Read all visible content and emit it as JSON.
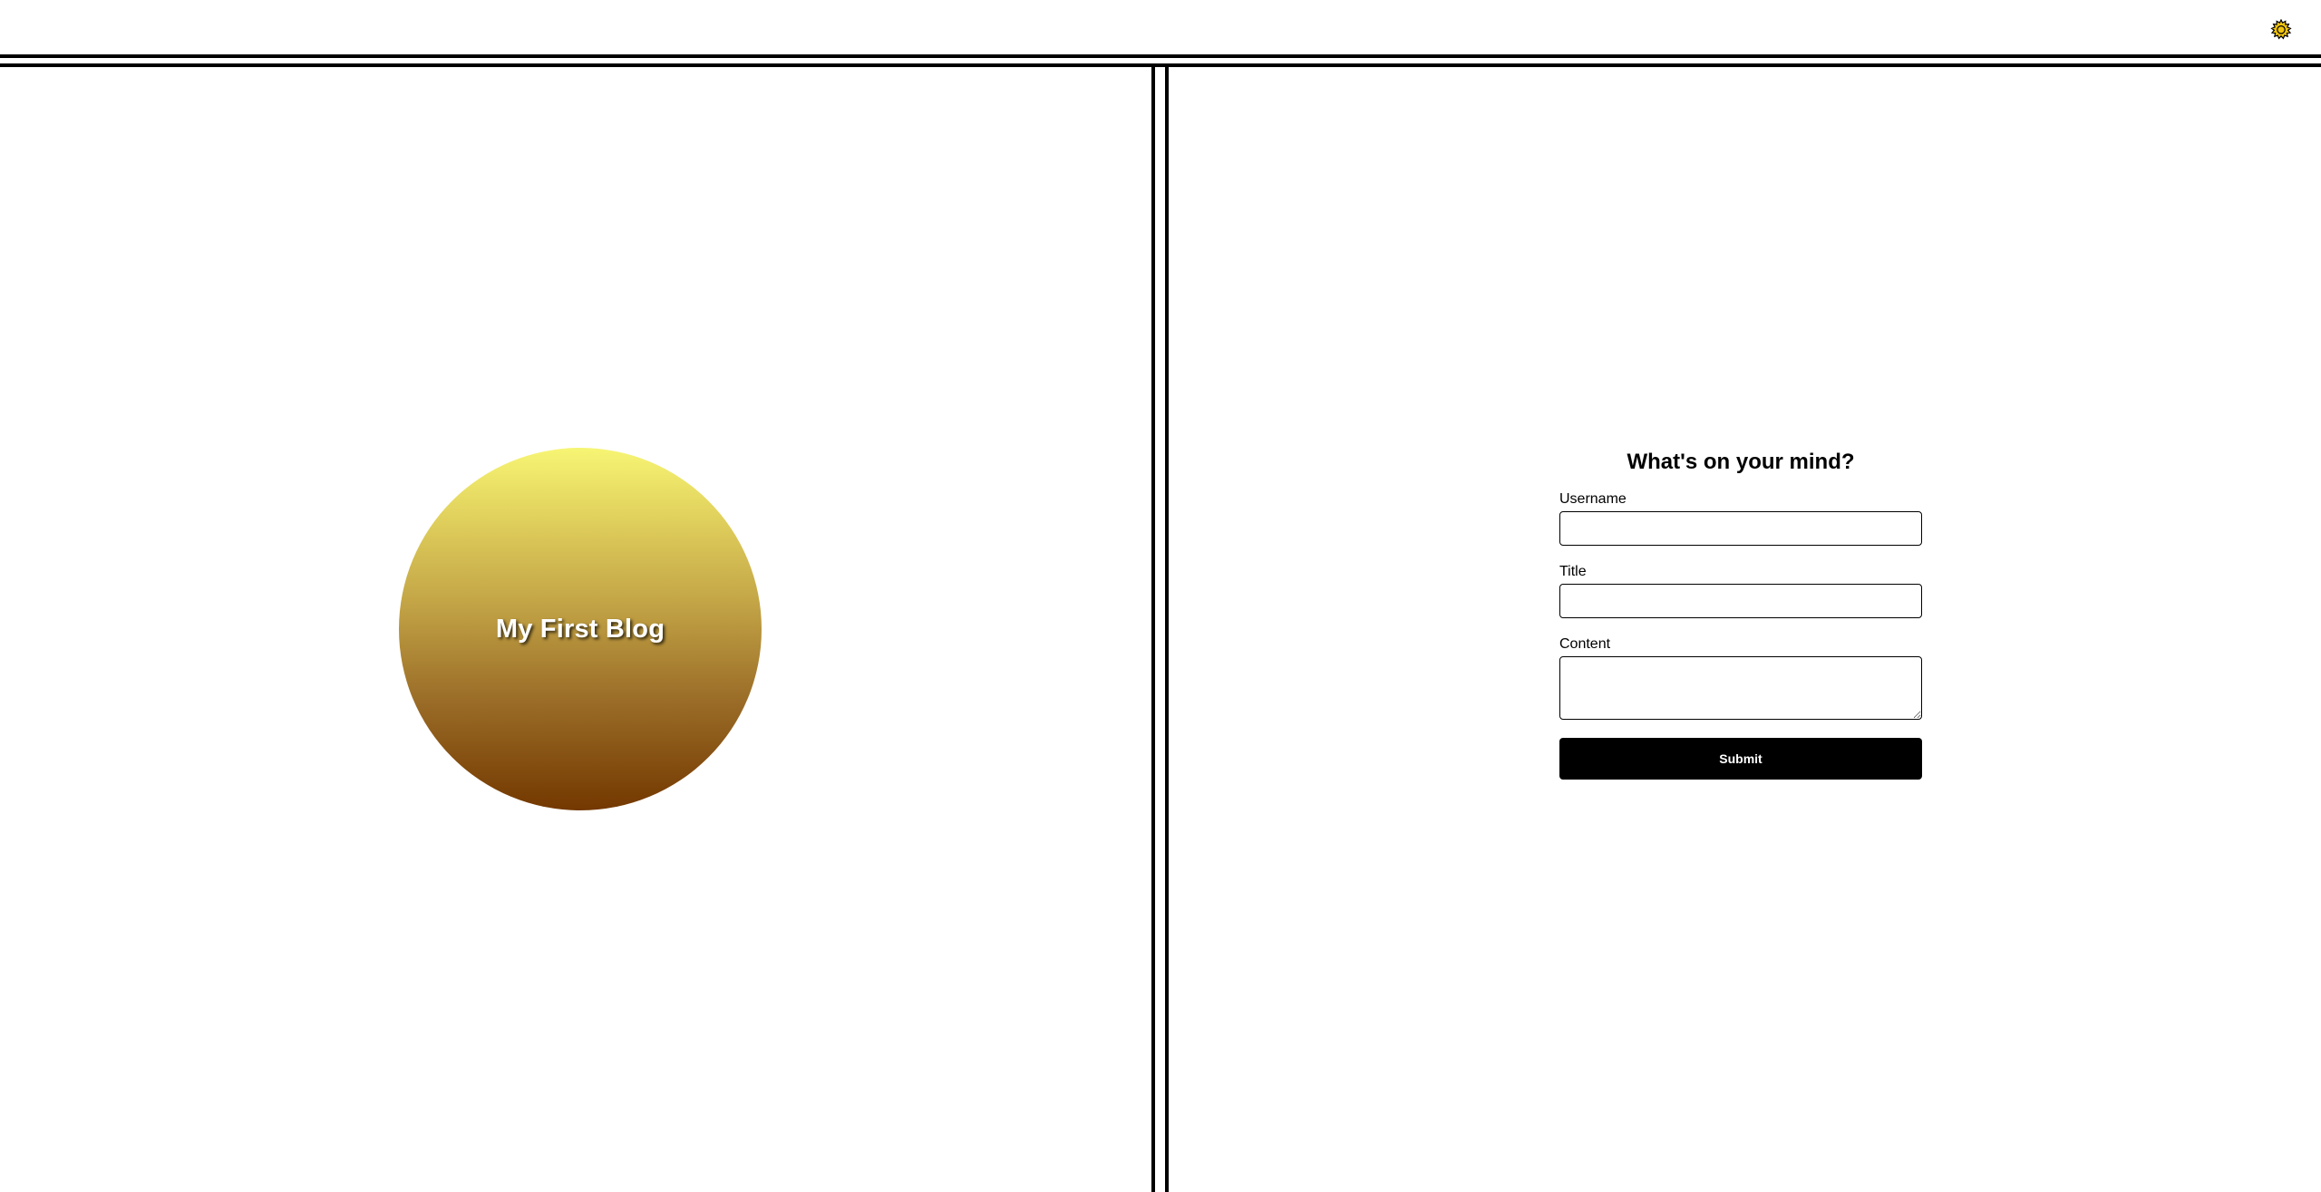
{
  "header": {
    "theme_toggle_icon": "sun-icon",
    "theme_toggle_color": "#f1c40f"
  },
  "hero": {
    "title": "My First Blog",
    "gradient_top": "#f7f574",
    "gradient_bottom": "#733800"
  },
  "form": {
    "heading": "What's on your mind?",
    "username_label": "Username",
    "username_value": "",
    "title_label": "Title",
    "title_value": "",
    "content_label": "Content",
    "content_value": "",
    "submit_label": "Submit"
  }
}
